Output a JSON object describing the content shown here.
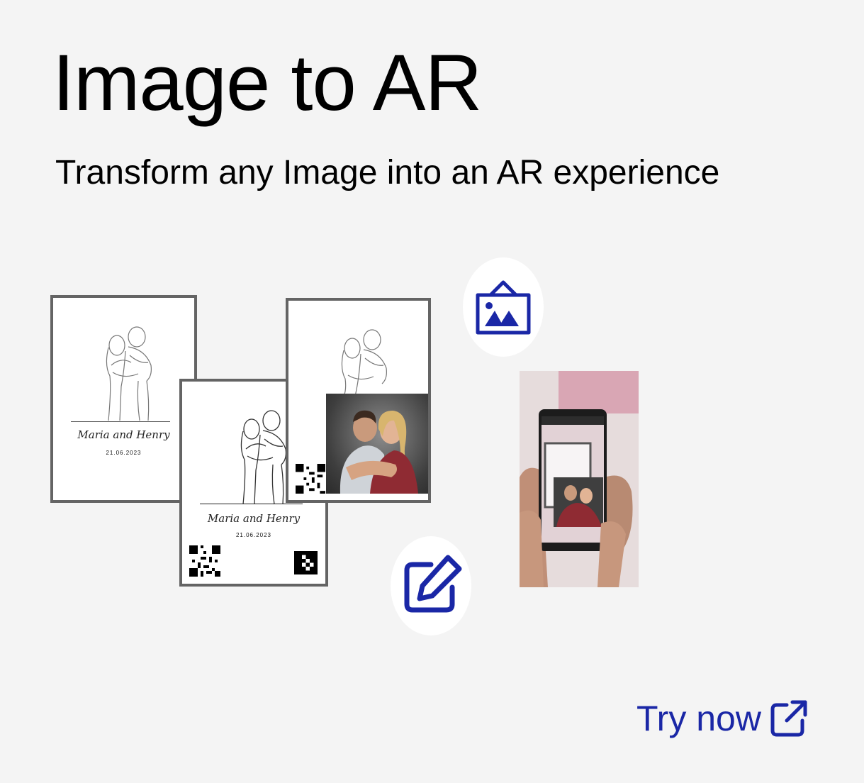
{
  "header": {
    "title": "Image to AR",
    "subtitle": "Transform any Image into an AR experience"
  },
  "cards": {
    "names": "Maria and Henry",
    "date": "21.06.2023"
  },
  "icons": {
    "image_frame": "framed-picture-icon",
    "edit": "edit-icon",
    "external_link": "external-link-icon"
  },
  "cta": {
    "label": "Try now"
  },
  "colors": {
    "accent": "#1a27a6",
    "background": "#f4f4f4",
    "card_border": "#646464"
  }
}
